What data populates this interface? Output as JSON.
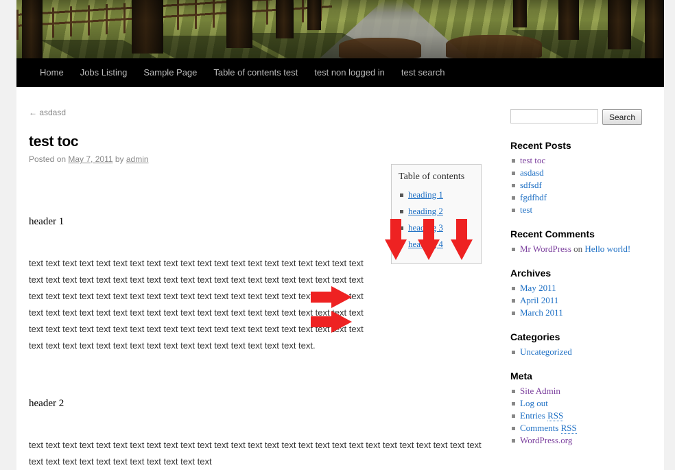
{
  "site": {
    "header_image_alt": "tree-lined-path-header-image"
  },
  "nav": {
    "items": [
      {
        "label": "Home"
      },
      {
        "label": "Jobs Listing"
      },
      {
        "label": "Sample Page"
      },
      {
        "label": "Table of contents test"
      },
      {
        "label": "test non logged in"
      },
      {
        "label": "test search"
      }
    ]
  },
  "post": {
    "previous_link": "← asdasd",
    "title": "test toc",
    "meta_prefix": "Posted on ",
    "date": "May 7, 2011",
    "meta_by": " by ",
    "author": "admin",
    "heading_1": "header 1",
    "heading_2": "header 2",
    "paragraph_1": "text text text text text text text text text text text text text text text text text text text text text text text text text text text text text text text text text text text text text text text text text text text text text text text text text text text text text text text text text text text text text text text text text text text text text text text text text text text text text text text text text text text text text text text text text text text text text text text text text text text text text text text text text text text text text text text text text text text text text.",
    "paragraph_2": "text text text text text text text text text text text text text text text text text text text text text text text text text text text text text text text text text text text text text text"
  },
  "toc": {
    "title": "Table of contents",
    "items": [
      {
        "label": "heading 1"
      },
      {
        "label": "heading 2"
      },
      {
        "label": "heading 3"
      },
      {
        "label": "heading 4"
      }
    ]
  },
  "annotations": {
    "arrow_color": "#ee2222",
    "down_arrows": 3,
    "right_arrows": 2
  },
  "sidebar": {
    "search": {
      "value": "",
      "placeholder": "",
      "button_label": "Search"
    },
    "recent_posts": {
      "title": "Recent Posts",
      "items": [
        {
          "label": "test toc",
          "visited": true
        },
        {
          "label": "asdasd",
          "visited": false
        },
        {
          "label": "sdfsdf",
          "visited": false
        },
        {
          "label": "fgdfhdf",
          "visited": false
        },
        {
          "label": "test",
          "visited": false
        }
      ]
    },
    "recent_comments": {
      "title": "Recent Comments",
      "author": "Mr WordPress",
      "on": " on ",
      "post": "Hello world!"
    },
    "archives": {
      "title": "Archives",
      "items": [
        {
          "label": "May 2011"
        },
        {
          "label": "April 2011"
        },
        {
          "label": "March 2011"
        }
      ]
    },
    "categories": {
      "title": "Categories",
      "items": [
        {
          "label": "Uncategorized"
        }
      ]
    },
    "meta": {
      "title": "Meta",
      "items": [
        {
          "label": "Site Admin",
          "visited": true
        },
        {
          "label": "Log out",
          "visited": false
        },
        {
          "label": "Entries ",
          "abbr": "RSS",
          "visited": false
        },
        {
          "label": "Comments ",
          "abbr": "RSS",
          "visited": false
        },
        {
          "label": "WordPress.org",
          "visited": true
        }
      ]
    }
  },
  "colors": {
    "page_background": "#f1f1f1",
    "content_background": "#ffffff",
    "nav_background": "#000000",
    "link": "#1d6fc4",
    "visited_link": "#7b3f9d",
    "accent_red": "#ee2222"
  }
}
